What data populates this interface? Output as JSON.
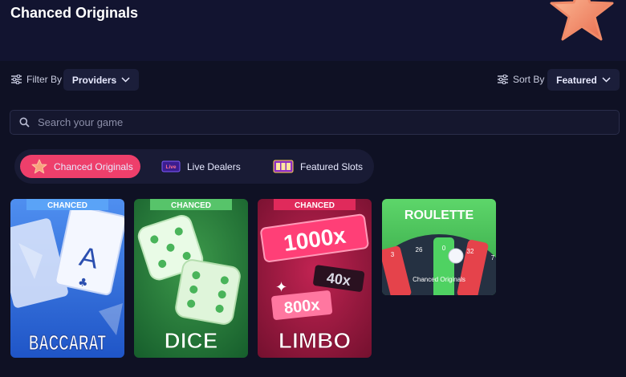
{
  "header": {
    "title": "Chanced Originals"
  },
  "filter": {
    "label": "Filter By",
    "value": "Providers"
  },
  "sort": {
    "label": "Sort By",
    "value": "Featured"
  },
  "search": {
    "placeholder": "Search your game"
  },
  "tabs": [
    {
      "label": "Chanced Originals",
      "active": true,
      "icon": "star-icon"
    },
    {
      "label": "Live Dealers",
      "active": false,
      "icon": "live-icon"
    },
    {
      "label": "Featured Slots",
      "active": false,
      "icon": "slots-icon"
    }
  ],
  "games": [
    {
      "brand": "CHANCED",
      "title": "BACCARAT",
      "card_letter": "A"
    },
    {
      "brand": "CHANCED",
      "title": "DICE"
    },
    {
      "brand": "CHANCED",
      "title": "LIMBO",
      "multipliers": [
        "1000x",
        "40x",
        "800x"
      ]
    },
    {
      "title": "ROULETTE",
      "subtitle": "Chanced Originals",
      "numbers": [
        "3",
        "26",
        "0",
        "32",
        "7"
      ]
    }
  ],
  "colors": {
    "accent": "#ee3f6b",
    "background": "#0f1124",
    "panel": "#1b1e3a"
  }
}
